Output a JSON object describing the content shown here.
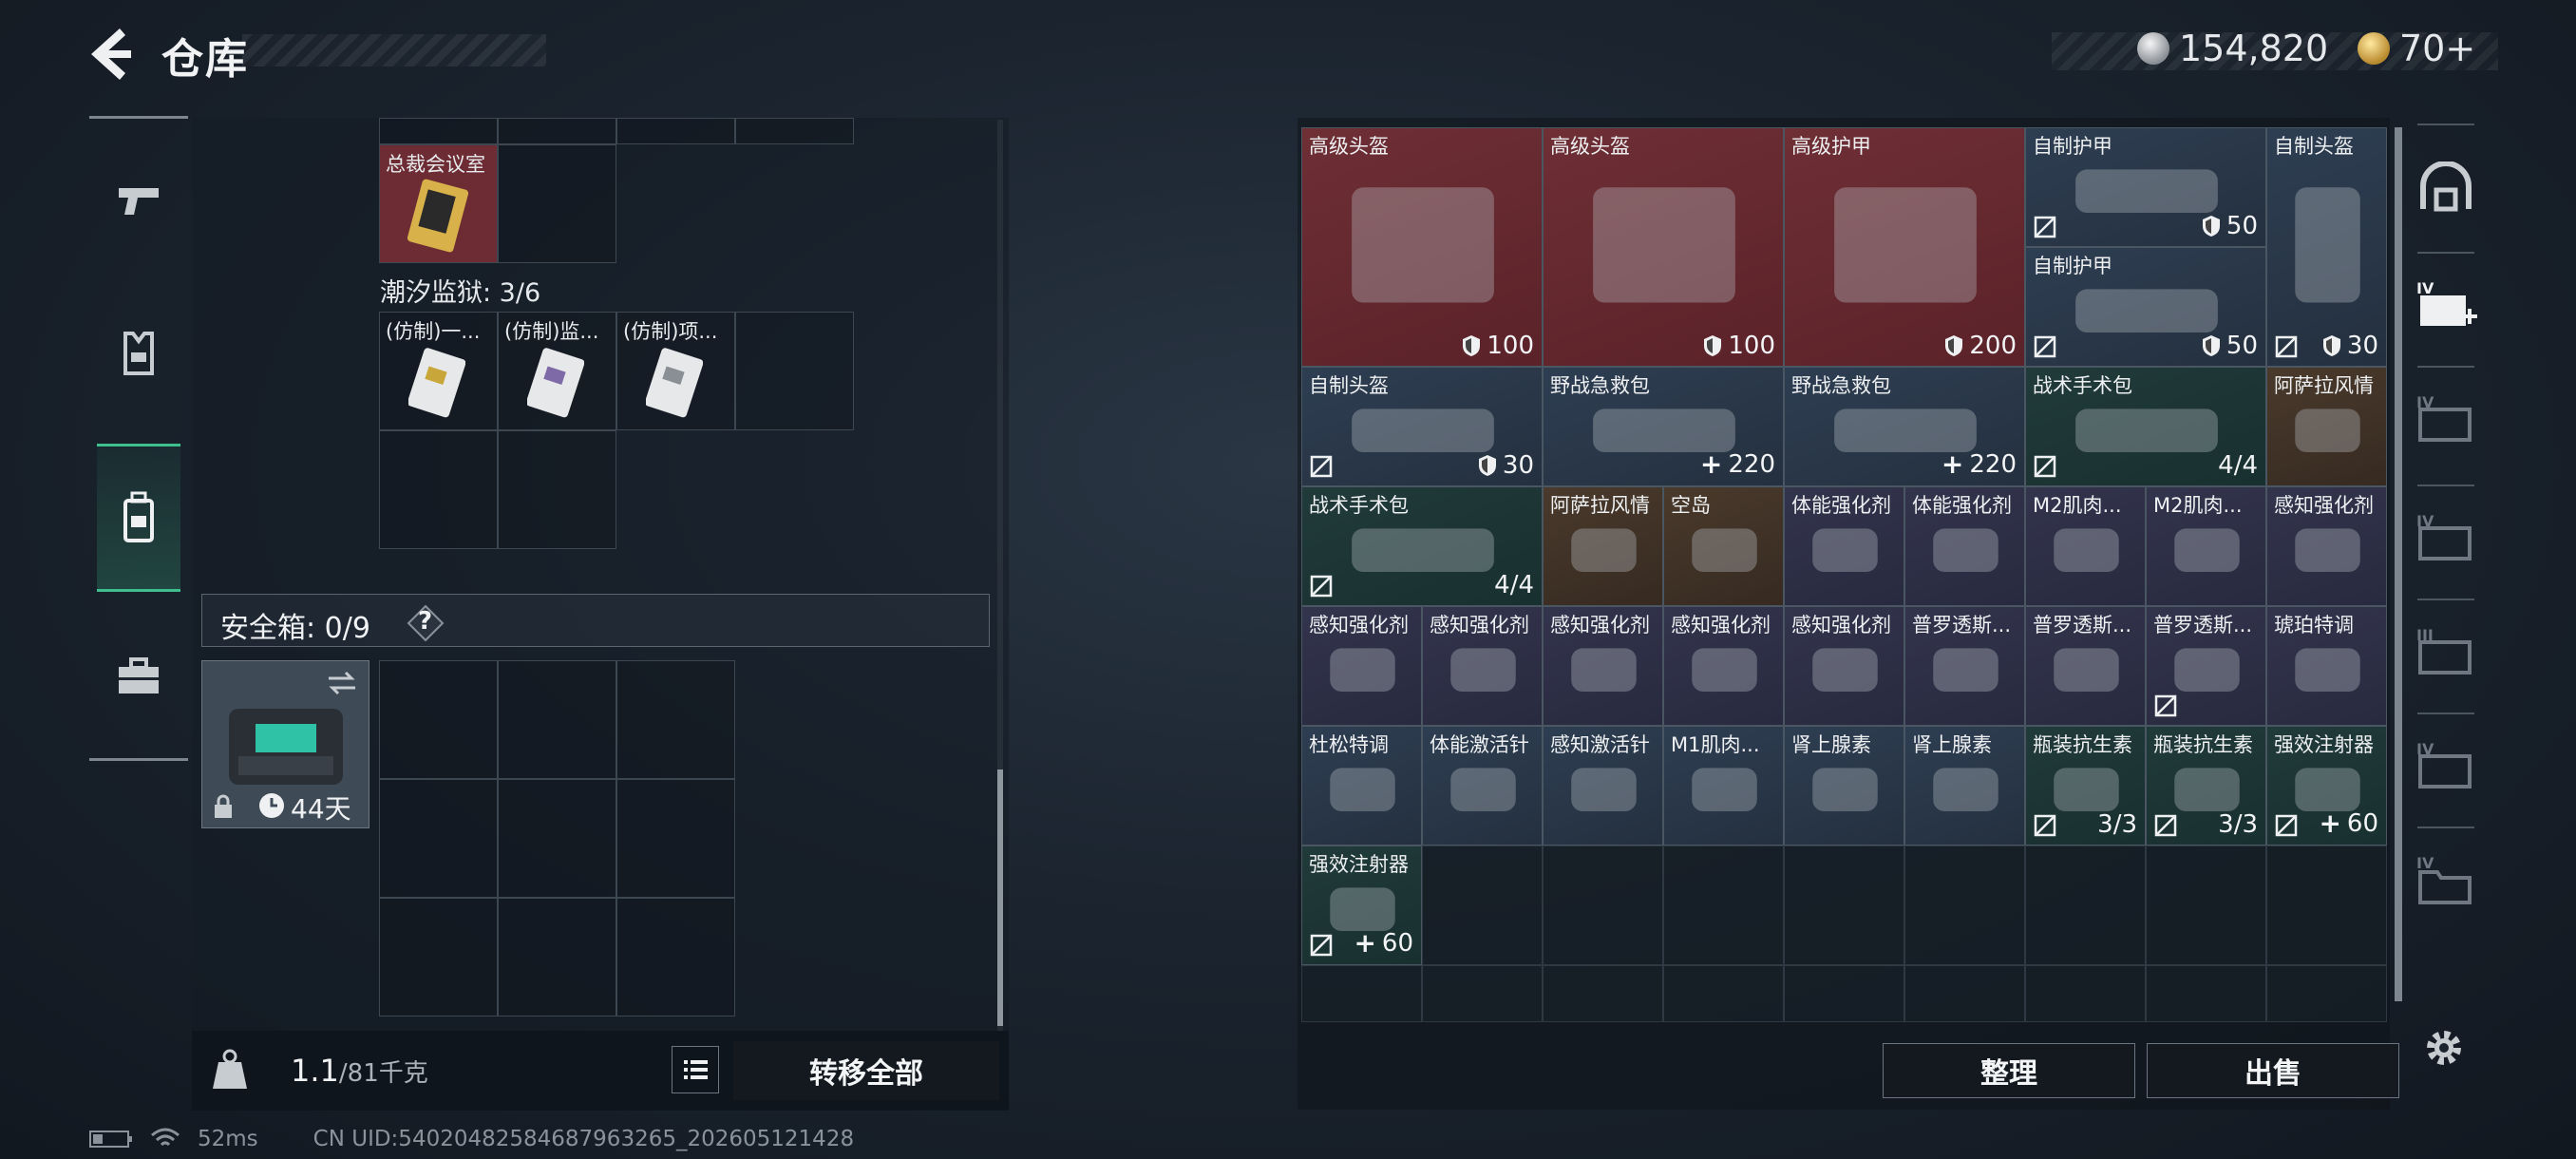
{
  "header": {
    "title": "仓库"
  },
  "currency": {
    "silver": "154,820",
    "gold": "70+"
  },
  "left": {
    "item_executive": "总裁会议室",
    "section_tide": "潮汐监狱: 3/6",
    "tide_items": [
      "(仿制)一...",
      "(仿制)监...",
      "(仿制)项..."
    ],
    "safe_label": "安全箱: 0/9",
    "help": "?",
    "safe_days": "44天",
    "weight_value": "1.1",
    "weight_max": "/81千克",
    "transfer_all": "转移全部",
    "status_ping": "52ms",
    "status_uid": "CN UID:5402048258468796326​5_202605121428"
  },
  "grid": {
    "rows": [
      [
        {
          "name": "高级头盔",
          "value": "100",
          "icon": "shield",
          "bg": "red",
          "span": 2,
          "nosell": false
        },
        {
          "name": "高级头盔",
          "value": "100",
          "icon": "shield",
          "bg": "red",
          "span": 2,
          "nosell": false
        },
        {
          "name": "高级护甲",
          "value": "200",
          "icon": "shield",
          "bg": "red",
          "span": 2,
          "nosell": false
        }
      ]
    ],
    "row1_extra": [
      {
        "name": "自制护甲",
        "value": "50",
        "icon": "shield",
        "bg": "blue",
        "nosell": true
      },
      {
        "name": "自制护甲",
        "value": "50",
        "icon": "shield",
        "bg": "blue",
        "nosell": true
      },
      {
        "name": "自制头盔",
        "value": "30",
        "icon": "shield",
        "bg": "blue",
        "nosell": true
      }
    ],
    "row2": [
      {
        "name": "自制头盔",
        "value": "30",
        "icon": "shield",
        "bg": "blue",
        "nosell": true
      },
      {
        "name": "野战急救包",
        "value": "220",
        "icon": "plus",
        "bg": "blue",
        "nosell": false
      },
      {
        "name": "野战急救包",
        "value": "220",
        "icon": "plus",
        "bg": "blue",
        "nosell": false
      },
      {
        "name": "战术手术包",
        "value": "4/4",
        "icon": "",
        "bg": "teal",
        "nosell": true
      },
      {
        "name": "阿萨拉风情",
        "value": "",
        "icon": "",
        "bg": "brown",
        "nosell": false
      }
    ],
    "row3": [
      {
        "name": "战术手术包",
        "value": "4/4",
        "icon": "",
        "bg": "teal",
        "nosell": true
      },
      {
        "name": "阿萨拉风情",
        "value": "",
        "icon": "",
        "bg": "brown",
        "nosell": false
      },
      {
        "name": "空岛",
        "value": "",
        "icon": "",
        "bg": "brown",
        "nosell": false
      },
      {
        "name": "体能强化剂",
        "value": "",
        "icon": "",
        "bg": "purple",
        "nosell": false
      },
      {
        "name": "体能强化剂",
        "value": "",
        "icon": "",
        "bg": "purple",
        "nosell": false
      },
      {
        "name": "M2肌肉...",
        "value": "",
        "icon": "",
        "bg": "purple",
        "nosell": false
      },
      {
        "name": "M2肌肉...",
        "value": "",
        "icon": "",
        "bg": "purple",
        "nosell": false
      },
      {
        "name": "感知强化剂",
        "value": "",
        "icon": "",
        "bg": "purple",
        "nosell": false
      }
    ],
    "row4": [
      {
        "name": "感知强化剂",
        "value": "",
        "icon": "",
        "bg": "purple",
        "nosell": false
      },
      {
        "name": "感知强化剂",
        "value": "",
        "icon": "",
        "bg": "purple",
        "nosell": false
      },
      {
        "name": "感知强化剂",
        "value": "",
        "icon": "",
        "bg": "purple",
        "nosell": false
      },
      {
        "name": "感知强化剂",
        "value": "",
        "icon": "",
        "bg": "purple",
        "nosell": false
      },
      {
        "name": "感知强化剂",
        "value": "",
        "icon": "",
        "bg": "purple",
        "nosell": false
      },
      {
        "name": "普罗透斯...",
        "value": "",
        "icon": "",
        "bg": "purple",
        "nosell": false
      },
      {
        "name": "普罗透斯...",
        "value": "",
        "icon": "",
        "bg": "purple",
        "nosell": false
      },
      {
        "name": "普罗透斯...",
        "value": "",
        "icon": "",
        "bg": "purple",
        "nosell": true
      },
      {
        "name": "琥珀特调",
        "value": "",
        "icon": "",
        "bg": "purple",
        "nosell": false
      }
    ],
    "row5": [
      {
        "name": "杜松特调",
        "value": "",
        "icon": "",
        "bg": "blue",
        "nosell": false
      },
      {
        "name": "体能激活针",
        "value": "",
        "icon": "",
        "bg": "blue",
        "nosell": false
      },
      {
        "name": "感知激活针",
        "value": "",
        "icon": "",
        "bg": "blue",
        "nosell": false
      },
      {
        "name": "M1肌肉...",
        "value": "",
        "icon": "",
        "bg": "blue",
        "nosell": false
      },
      {
        "name": "肾上腺素",
        "value": "",
        "icon": "",
        "bg": "blue",
        "nosell": false
      },
      {
        "name": "肾上腺素",
        "value": "",
        "icon": "",
        "bg": "blue",
        "nosell": false
      },
      {
        "name": "瓶装抗生素",
        "value": "3/3",
        "icon": "",
        "bg": "teal",
        "nosell": true
      },
      {
        "name": "瓶装抗生素",
        "value": "3/3",
        "icon": "",
        "bg": "teal",
        "nosell": true
      },
      {
        "name": "强效注射器",
        "value": "60",
        "icon": "plus",
        "bg": "teal",
        "nosell": true
      }
    ],
    "row6": [
      {
        "name": "强效注射器",
        "value": "60",
        "icon": "plus",
        "bg": "teal",
        "nosell": true
      }
    ]
  },
  "buttons": {
    "sort": "整理",
    "sell": "出售"
  },
  "side_tabs": [
    "",
    "IV",
    "IV",
    "IV",
    "III",
    "IV",
    "IV"
  ],
  "colors": {
    "accent": "#3fbf8e",
    "red_item": "#6e2f35",
    "blue_item": "#2e3e52"
  }
}
